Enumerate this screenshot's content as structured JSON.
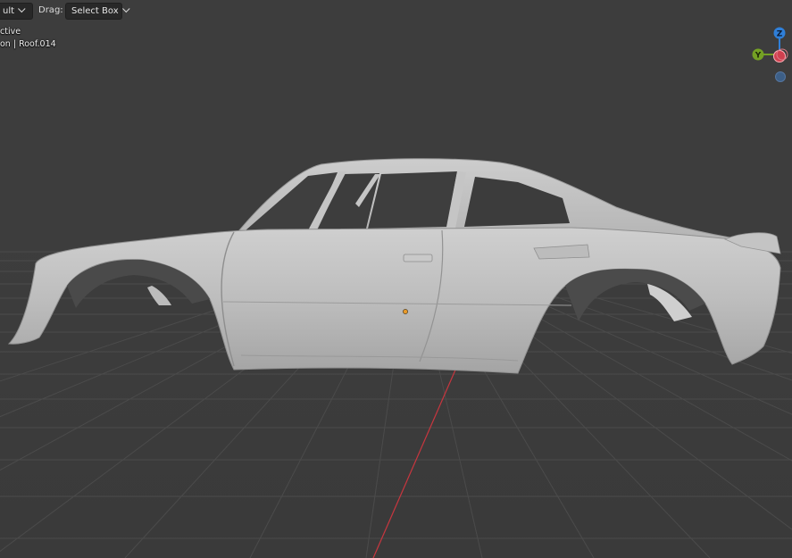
{
  "header": {
    "shading_mode_label": "ult",
    "drag_label": "Drag:",
    "drag_mode": "Select Box"
  },
  "overlay": {
    "line1": "ctive",
    "line2": "on | Roof.014"
  },
  "gizmo": {
    "z_label": "Z",
    "y_label": "Y",
    "colors": {
      "z": "#2f7fd8",
      "y": "#74a124",
      "x": "#d0404f",
      "neg": "#3d5f87"
    }
  },
  "scene": {
    "background": "#3d3d3d",
    "grid_color": "#4a4a4a",
    "axis_line_color": "#c8363f",
    "origin_color": "#e89a2a",
    "model_color": "#b7b7b7"
  }
}
